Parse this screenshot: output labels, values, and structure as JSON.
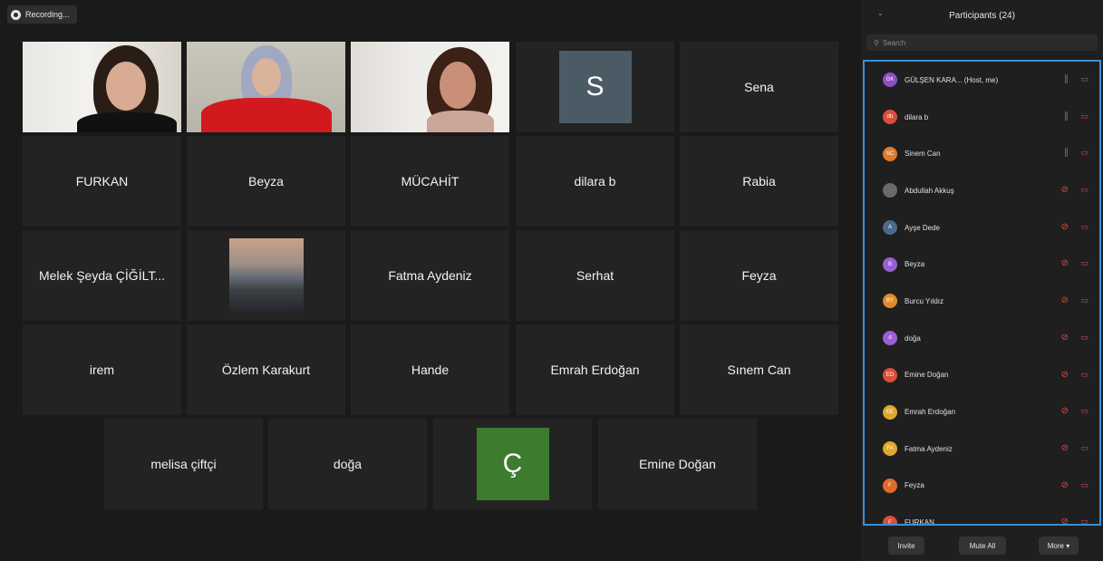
{
  "recording": {
    "label": "Recording..."
  },
  "gallery": {
    "row1": [
      {
        "type": "video"
      },
      {
        "type": "video"
      },
      {
        "type": "video"
      },
      {
        "type": "letter",
        "letter": "S",
        "color": "#4a5b66"
      },
      {
        "type": "name",
        "name": "Sena"
      }
    ],
    "row2": [
      "FURKAN",
      "Beyza",
      "MÜCAHİT",
      "dilara b",
      "Rabia"
    ],
    "row3": [
      "Melek Şeyda ÇİĞİLT...",
      "",
      "Fatma Aydeniz",
      "Serhat",
      "Feyza"
    ],
    "row4": [
      "irem",
      "Özlem Karakurt",
      "Hande",
      "Emrah Erdoğan",
      "Sınem Can"
    ],
    "row5": [
      "melisa çiftçi",
      "doğa",
      "",
      "Emine Doğan"
    ],
    "letter_c": {
      "letter": "Ç",
      "color": "#3d7c2e"
    }
  },
  "participants": {
    "title": "Participants (24)",
    "search_placeholder": "Search",
    "list": [
      {
        "initials": "GK",
        "name": "GÜLŞEN KARA...  (Host, me)",
        "color": "#8e4fc2",
        "mic": "open",
        "cam": "open"
      },
      {
        "initials": "db",
        "name": "dilara b",
        "color": "#d94f3a",
        "mic": "open",
        "cam": "muted"
      },
      {
        "initials": "SC",
        "name": "Sinem Can",
        "color": "#e07a2b",
        "mic": "open",
        "cam": "muted"
      },
      {
        "initials": "",
        "name": "Abdullah Akkuş",
        "color": "#6a6a6a",
        "mic": "muted",
        "cam": "muted"
      },
      {
        "initials": "A",
        "name": "Ayşe Dede",
        "color": "#4a6a8a",
        "mic": "muted",
        "cam": "muted"
      },
      {
        "initials": "B",
        "name": "Beyza",
        "color": "#9a5fd6",
        "mic": "muted",
        "cam": "muted"
      },
      {
        "initials": "BY",
        "name": "Burcu Yıldız",
        "color": "#e08a2b",
        "mic": "muted",
        "cam": "open"
      },
      {
        "initials": "d",
        "name": "doğa",
        "color": "#9a5fd6",
        "mic": "muted",
        "cam": "muted"
      },
      {
        "initials": "ED",
        "name": "Emine Doğan",
        "color": "#d94f3a",
        "mic": "muted",
        "cam": "muted"
      },
      {
        "initials": "EE",
        "name": "Emrah Erdoğan",
        "color": "#e0a82b",
        "mic": "muted",
        "cam": "muted"
      },
      {
        "initials": "FA",
        "name": "Fatma Aydeniz",
        "color": "#e0a82b",
        "mic": "muted",
        "cam": "muted"
      },
      {
        "initials": "F",
        "name": "Feyza",
        "color": "#e06a2b",
        "mic": "muted",
        "cam": "muted"
      },
      {
        "initials": "F",
        "name": "FURKAN",
        "color": "#d94f3a",
        "mic": "muted",
        "cam": "muted"
      }
    ],
    "buttons": {
      "invite": "Invite",
      "mute_all": "Mute All",
      "more": "More ▾"
    }
  }
}
